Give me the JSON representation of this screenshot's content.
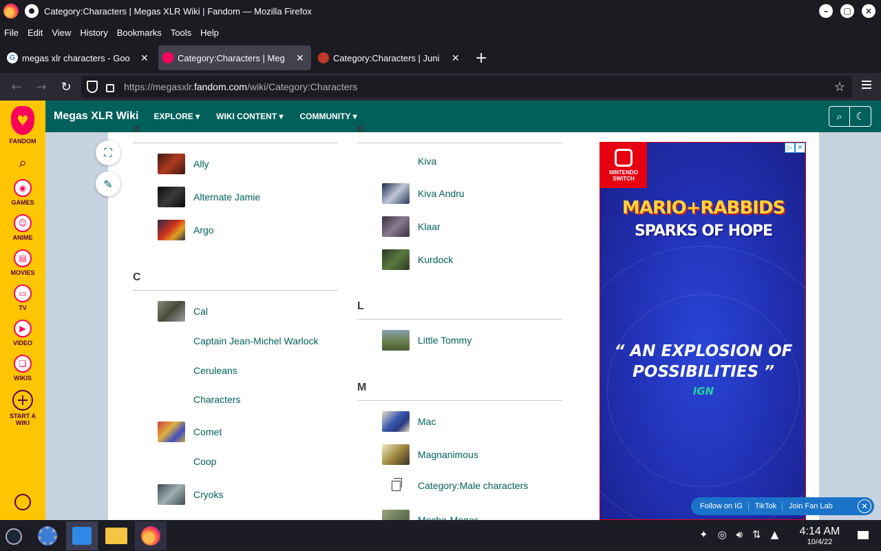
{
  "window": {
    "title": "Category:Characters | Megas XLR Wiki | Fandom — Mozilla Firefox",
    "buttons": {
      "minimize": "–",
      "maximize": "▢",
      "close": "×"
    }
  },
  "menubar": [
    "File",
    "Edit",
    "View",
    "History",
    "Bookmarks",
    "Tools",
    "Help"
  ],
  "tabs": [
    {
      "label": "megas xlr characters - Goo",
      "favicon": "google-icon",
      "active": false
    },
    {
      "label": "Category:Characters | Meg",
      "favicon": "fandom-icon",
      "active": true
    },
    {
      "label": "Category:Characters | Juni",
      "favicon": "fox-icon",
      "active": false
    }
  ],
  "newtab_label": "+",
  "url": {
    "prefix": "https://megasxlr.",
    "domain": "fandom.com",
    "path": "/wiki/Category:Characters"
  },
  "rail": {
    "brand": "FANDOM",
    "items": [
      {
        "label": "GAMES",
        "icon": "games-icon"
      },
      {
        "label": "ANIME",
        "icon": "anime-icon"
      },
      {
        "label": "MOVIES",
        "icon": "movies-icon"
      },
      {
        "label": "TV",
        "icon": "tv-icon"
      },
      {
        "label": "VIDEO",
        "icon": "video-icon"
      },
      {
        "label": "WIKIS",
        "icon": "wikis-icon"
      }
    ],
    "start_wiki": "START A WIKI"
  },
  "wiki": {
    "name": "Megas XLR Wiki",
    "nav": [
      "EXPLORE",
      "WIKI CONTENT",
      "COMMUNITY"
    ]
  },
  "columns": [
    {
      "sections": [
        {
          "letter": "A",
          "entries": [
            {
              "name": "Ally",
              "thumb": "#8b2a1e"
            },
            {
              "name": "Alternate Jamie",
              "thumb": "#1a1a1a"
            },
            {
              "name": "Argo",
              "thumb": "#c02828"
            }
          ]
        },
        {
          "letter": "C",
          "entries": [
            {
              "name": "Cal",
              "thumb": "#6b6b5a"
            },
            {
              "name": "Captain Jean-Michel Warlock",
              "thumb": ""
            },
            {
              "name": "Ceruleans",
              "thumb": ""
            },
            {
              "name": "Characters",
              "thumb": ""
            },
            {
              "name": "Comet",
              "thumb": "#d9a040"
            },
            {
              "name": "Coop",
              "thumb": ""
            },
            {
              "name": "Cryoks",
              "thumb": "#5a6a70"
            }
          ]
        }
      ]
    },
    {
      "sections": [
        {
          "letter": "K",
          "entries": [
            {
              "name": "Kiva",
              "thumb": ""
            },
            {
              "name": "Kiva Andru",
              "thumb": "#2a3a5a"
            },
            {
              "name": "Klaar",
              "thumb": "#5a4e60"
            },
            {
              "name": "Kurdock",
              "thumb": "#3e5a30"
            }
          ]
        },
        {
          "letter": "L",
          "entries": [
            {
              "name": "Little Tommy",
              "thumb": "#6a7a4a"
            }
          ]
        },
        {
          "letter": "M",
          "entries": [
            {
              "name": "Mac",
              "thumb": "#3a5ab0"
            },
            {
              "name": "Magnanimous",
              "thumb": "#b09a50"
            },
            {
              "name": "Category:Male characters",
              "thumb": "category"
            },
            {
              "name": "Mecha-Megas",
              "thumb": "#7a8a6a"
            }
          ]
        }
      ]
    }
  ],
  "ad": {
    "brand_top": "NINTENDO",
    "brand_bottom": "SWITCH",
    "title_line1": "MARIO+RABBIDS",
    "title_line2": "SPARKS OF HOPE",
    "quote": "“ AN EXPLOSION OF POSSIBILITIES ”",
    "source": "IGN"
  },
  "fanbar": [
    "Follow on IG",
    "TikTok",
    "Join Fan Lab"
  ],
  "taskbar": {
    "time": "4:14 AM",
    "date": "10/4/22"
  }
}
